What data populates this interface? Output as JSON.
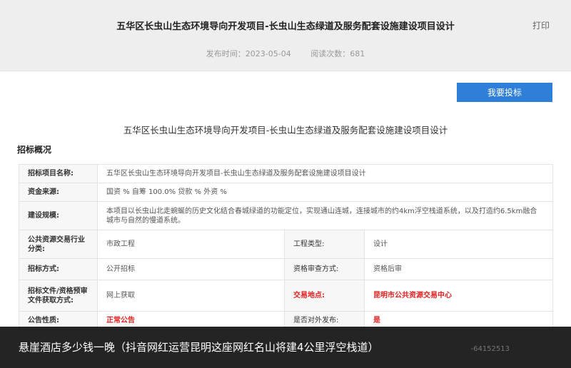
{
  "header": {
    "title": "五华区长虫山生态环境导向开发项目-长虫山生态绿道及服务配套设施建设项目设计",
    "print_label": "打印",
    "publish_time": "发布时间：2023-05-04",
    "read_count": "阅读次数：681"
  },
  "actions": {
    "bid_label": "我要投标"
  },
  "document": {
    "title": "五华区长虫山生态环境导向开发项目-长虫山生态绿道及服务配套设施建设项目设计",
    "section_title": "招标概况"
  },
  "table": {
    "project_name_label": "招标项目名称:",
    "project_name_value": "五华区长虫山生态环境导向开发项目-长虫山生态绿道及服务配套设施建设项目设计",
    "funding_label": "资金来源:",
    "funding_value": "国资 % 自筹 100.0% 贷款 % 外资 %",
    "scale_label": "建设规模:",
    "scale_value": "本项目以长虫山北走蜿蜒的历史文化结合春城绿道的功能定位，实现通山连城，连接城市的约4km浮空栈道系统，以及打造约6.5km融合城市与自然的慢道系统。",
    "category_label": "公共资源交易行业分类:",
    "category_value": "市政工程",
    "engineering_type_label": "工程类型:",
    "engineering_type_value": "设计",
    "bid_method_label": "招标方式:",
    "bid_method_value": "公开招标",
    "qualification_label": "资格审查方式:",
    "qualification_value": "资格后审",
    "doc_obtain_label": "招标文件/资格预审文件获取方式:",
    "doc_obtain_value": "网上获取",
    "trade_location_label": "交易地点:",
    "trade_location_value": "昆明市公共资源交易中心",
    "nature_label": "公告性质:",
    "nature_value": "正常公告",
    "public_release_label": "是否对外发布:",
    "public_release_value": "是"
  },
  "caption": {
    "text": "悬崖酒店多少钱一晚（抖音网红运营昆明这座网红名山将建4公里浮空栈道）",
    "tail": "-64152513"
  }
}
